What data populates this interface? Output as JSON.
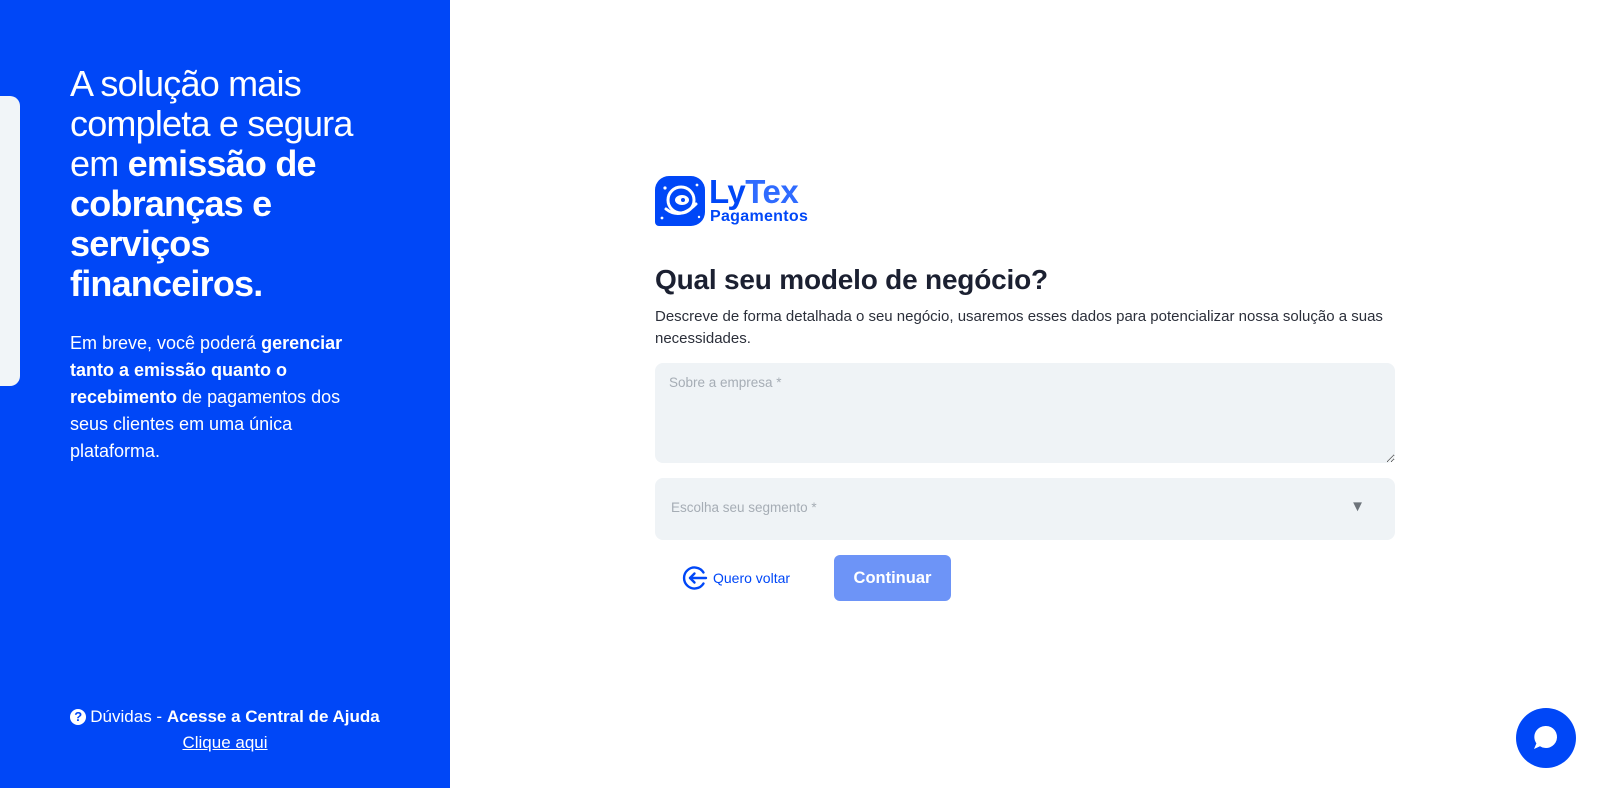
{
  "left_panel": {
    "headline": {
      "line1": "A solução mais",
      "line2": "completa e segura",
      "line3_plain": "em ",
      "line3_bold": "emissão de",
      "line4_bold": "cobranças e",
      "line5_bold": "serviços",
      "line6_bold": "financeiros."
    },
    "intro": {
      "part1": "Em breve, você poderá ",
      "bold1": "gerenciar tanto a emissão quanto o recebimento",
      "part2": " de pagamentos dos seus clientes em uma única plataforma."
    },
    "help": {
      "icon_glyph": "?",
      "prefix": "Dúvidas - ",
      "bold_text": "Acesse a Central de Ajuda",
      "link": "Clique aqui"
    }
  },
  "logo": {
    "ly": "Ly",
    "tex": "Tex",
    "sub": "Pagamentos"
  },
  "form": {
    "title": "Qual seu modelo de negócio?",
    "subtitle": "Descreve de forma detalhada o seu negócio, usaremos esses dados para potencializar nossa solução a suas necessidades.",
    "about_placeholder": "Sobre a empresa *",
    "segment_placeholder": "Escolha seu segmento *",
    "segment_arrow": "▼",
    "back_label": "Quero voltar",
    "continue_label": "Continuar"
  },
  "icons": {
    "logo": "astronaut-logo-icon",
    "back": "arrow-left-circle-icon",
    "help": "question-circle-icon",
    "chat": "chat-bubble-icon"
  },
  "colors": {
    "primary": "#0047f7",
    "button_disabled": "#6d94f7",
    "input_bg": "#eff3f6",
    "title": "#1b2031"
  }
}
